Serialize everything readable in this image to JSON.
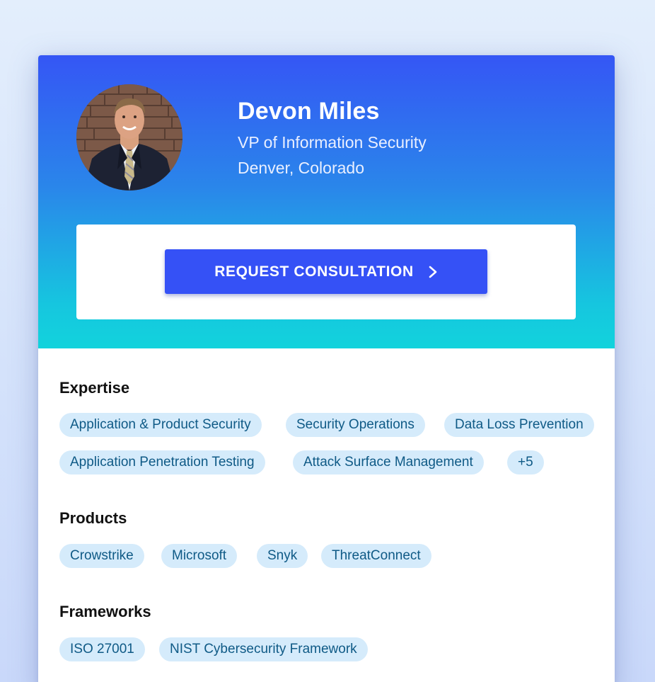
{
  "profile": {
    "name": "Devon Miles",
    "role": "VP of Information Security",
    "location": "Denver, Colorado"
  },
  "cta": {
    "label": "REQUEST CONSULTATION",
    "icon": "chevron-right-icon"
  },
  "expertise": {
    "title": "Expertise",
    "tags": [
      "Application & Product Security",
      "Security Operations",
      "Data Loss Prevention",
      "Application Penetration Testing",
      "Attack Surface Management",
      "+5"
    ]
  },
  "products": {
    "title": "Products",
    "tags": [
      "Crowstrike",
      "Microsoft",
      "Snyk",
      "ThreatConnect"
    ]
  },
  "frameworks": {
    "title": "Frameworks",
    "tags": [
      "ISO 27001",
      "NIST Cybersecurity Framework"
    ]
  },
  "colors": {
    "accent": "#3551f6",
    "hero_top": "#3556f5",
    "hero_bottom": "#12d3dc",
    "tag_bg": "#d5ebfb",
    "tag_text": "#0f5a86"
  }
}
